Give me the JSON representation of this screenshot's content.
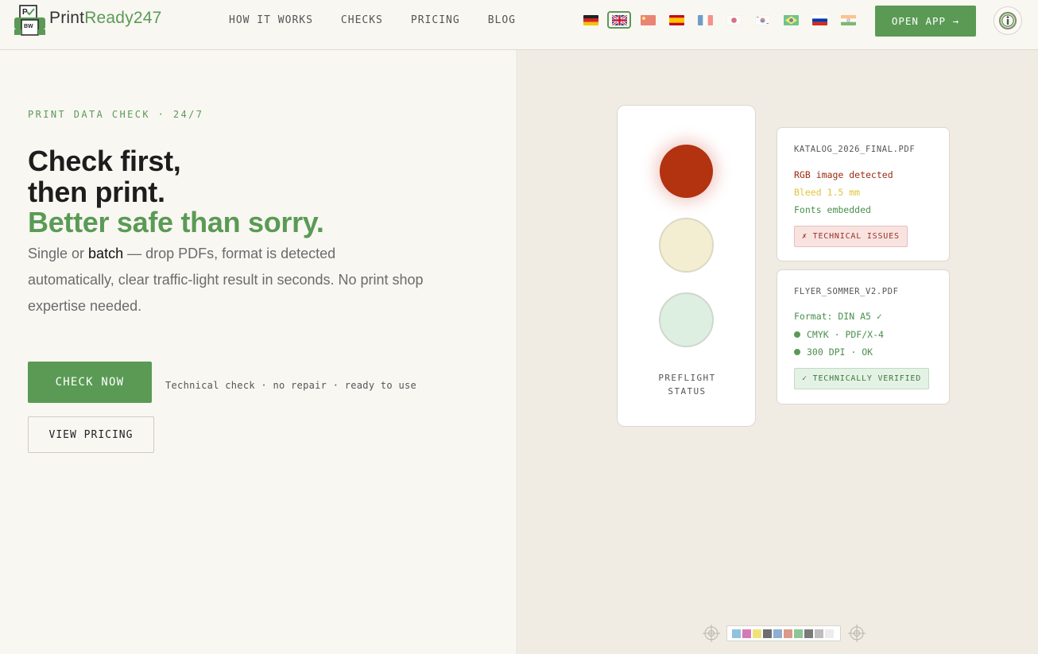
{
  "brand": {
    "name_part1": "Print",
    "name_part2": "Ready247",
    "icon_text": "P",
    "icon_subtext": "BW"
  },
  "nav": [
    {
      "id": "how-it-works",
      "label": "HOW IT WORKS"
    },
    {
      "id": "checks",
      "label": "CHECKS"
    },
    {
      "id": "pricing",
      "label": "PRICING"
    },
    {
      "id": "blog",
      "label": "BLOG"
    }
  ],
  "languages": [
    {
      "code": "de",
      "icon": "flag-de-icon",
      "active": false
    },
    {
      "code": "en",
      "icon": "flag-gb-icon",
      "active": true
    },
    {
      "code": "zh",
      "icon": "flag-cn-icon",
      "active": false
    },
    {
      "code": "es",
      "icon": "flag-es-icon",
      "active": false
    },
    {
      "code": "fr",
      "icon": "flag-fr-icon",
      "active": false
    },
    {
      "code": "ja",
      "icon": "flag-jp-icon",
      "active": false
    },
    {
      "code": "ko",
      "icon": "flag-kr-icon",
      "active": false
    },
    {
      "code": "pt",
      "icon": "flag-br-icon",
      "active": false
    },
    {
      "code": "ru",
      "icon": "flag-ru-icon",
      "active": false
    },
    {
      "code": "hi",
      "icon": "flag-in-icon",
      "active": false
    }
  ],
  "header": {
    "open_app_label": "OPEN APP →"
  },
  "hero": {
    "eyebrow": "PRINT DATA CHECK · 24/7",
    "title_line1": "Check first,",
    "title_line2": "then print.",
    "title_line3": "Better safe than sorry.",
    "lead_prefix": "Single or ",
    "lead_bold": "batch",
    "lead_suffix": " — drop PDFs, format is detected automatically, clear traffic-light result in seconds. No print shop expertise needed.",
    "primary_cta": "CHECK NOW",
    "cta_note": "Technical check · no repair · ready to use",
    "secondary_cta": "VIEW PRICING"
  },
  "preflight": {
    "label_line1": "PREFLIGHT",
    "label_line2": "STATUS",
    "active_light": "red"
  },
  "files": [
    {
      "name": "KATALOG_2026_FINAL.PDF",
      "lines": [
        "RGB image detected",
        "Bleed 1.5 mm",
        "Fonts embedded"
      ],
      "badge": "✗ TECHNICAL ISSUES"
    },
    {
      "name": "FLYER_SOMMER_V2.PDF",
      "lines": [
        "Format: DIN A5 ✓",
        "CMYK · PDF/X-4",
        "300 DPI · OK"
      ],
      "badge": "✓ TECHNICALLY VERIFIED"
    }
  ],
  "colors": {
    "accent": "#5a9a55",
    "error": "#9a2a12",
    "warning": "#e0c63a",
    "ok": "#4a8f4c",
    "swatches": [
      "#8ec3df",
      "#d67ab7",
      "#f0e27a",
      "#6e6e6e",
      "#8eaed2",
      "#d99a87",
      "#8cc596",
      "#7a7a7a",
      "#bdbdbd",
      "#ececec"
    ]
  }
}
